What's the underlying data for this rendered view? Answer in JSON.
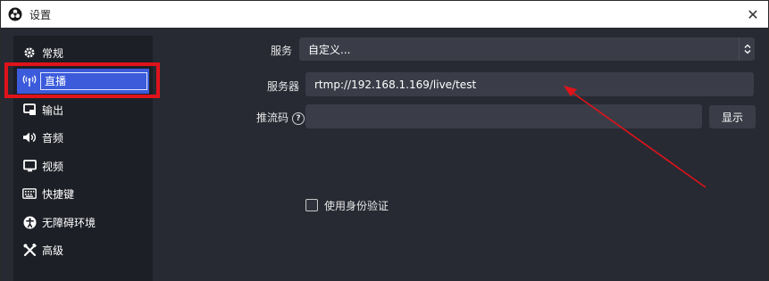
{
  "window": {
    "title": "设置"
  },
  "sidebar": {
    "items": [
      {
        "label": "常规",
        "icon": "gear-icon"
      },
      {
        "label": "直播",
        "icon": "broadcast-icon",
        "active": true
      },
      {
        "label": "输出",
        "icon": "output-icon"
      },
      {
        "label": "音频",
        "icon": "speaker-icon"
      },
      {
        "label": "视频",
        "icon": "monitor-icon"
      },
      {
        "label": "快捷键",
        "icon": "keyboard-icon"
      },
      {
        "label": "无障碍环境",
        "icon": "accessibility-icon"
      },
      {
        "label": "高级",
        "icon": "tools-icon"
      }
    ]
  },
  "stream": {
    "service_label": "服务",
    "service_value": "自定义...",
    "server_label": "服务器",
    "server_value": "rtmp://192.168.1.169/live/test",
    "key_label": "推流码",
    "key_value": "",
    "show_button": "显示",
    "auth_checkbox_label": "使用身份验证",
    "auth_checked": false
  },
  "colors": {
    "highlight": "#e0131a",
    "active_item": "#3b5bdb",
    "panel_bg": "#272a33",
    "sidebar_bg": "#1d1f26"
  }
}
